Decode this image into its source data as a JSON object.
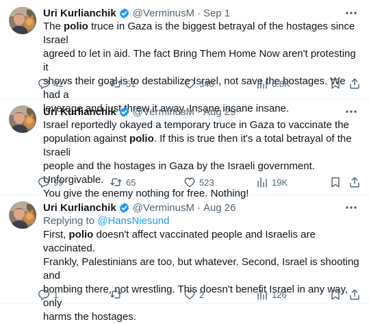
{
  "colors": {
    "text": "#0f1419",
    "muted": "#536471",
    "link": "#1d9bf0",
    "verified": "#1d9bf0"
  },
  "tweets": [
    {
      "name": "Uri Kurlianchik",
      "handle": "@VerminusM",
      "separator": "·",
      "date": "Sep 1",
      "reply_prefix": "",
      "reply_mention": "",
      "lines": [
        [
          "The ",
          "polio",
          " truce in Gaza is the biggest betrayal of the hostages since Israel"
        ],
        [
          "agreed to let in aid. The fact Bring Them Home Now aren't protesting it"
        ],
        [
          "shows their goal is to destabilize Israel, not save the hostages. We had a"
        ],
        [
          "leverage and just threw it away. Insane insane insane."
        ]
      ],
      "stats": {
        "replies": "41",
        "retweets": "51",
        "likes": "340",
        "views": "6.8K"
      }
    },
    {
      "name": "Uri Kurlianchik",
      "handle": "@VerminusM",
      "separator": "·",
      "date": "Aug 29",
      "reply_prefix": "",
      "reply_mention": "",
      "lines": [
        [
          "Israel reportedly okayed a temporary truce in Gaza to vaccinate the"
        ],
        [
          "population against ",
          "polio",
          ". If this is true then it's a total betrayal of the Israeli"
        ],
        [
          "people and the hostages in Gaza by the Israeli government. Unforgivable."
        ],
        [
          "You give the enemy nothing for free. Nothing!"
        ]
      ],
      "stats": {
        "replies": "99",
        "retweets": "65",
        "likes": "523",
        "views": "19K"
      }
    },
    {
      "name": "Uri Kurlianchik",
      "handle": "@VerminusM",
      "separator": "·",
      "date": "Aug 26",
      "reply_prefix": "Replying to ",
      "reply_mention": "@HansNiesund",
      "lines": [
        [
          "First, ",
          "polio",
          " doesn't affect vaccinated people and Israelis are vaccinated."
        ],
        [
          "Frankly, Palestinians are too, but whatever. Second, Israel is shooting and"
        ],
        [
          "bombing there, not wrestling. This doesn't benefit Israel in any way, only"
        ],
        [
          "harms the hostages."
        ]
      ],
      "stats": {
        "replies": "1",
        "retweets": "",
        "likes": "2",
        "views": "126"
      }
    }
  ]
}
